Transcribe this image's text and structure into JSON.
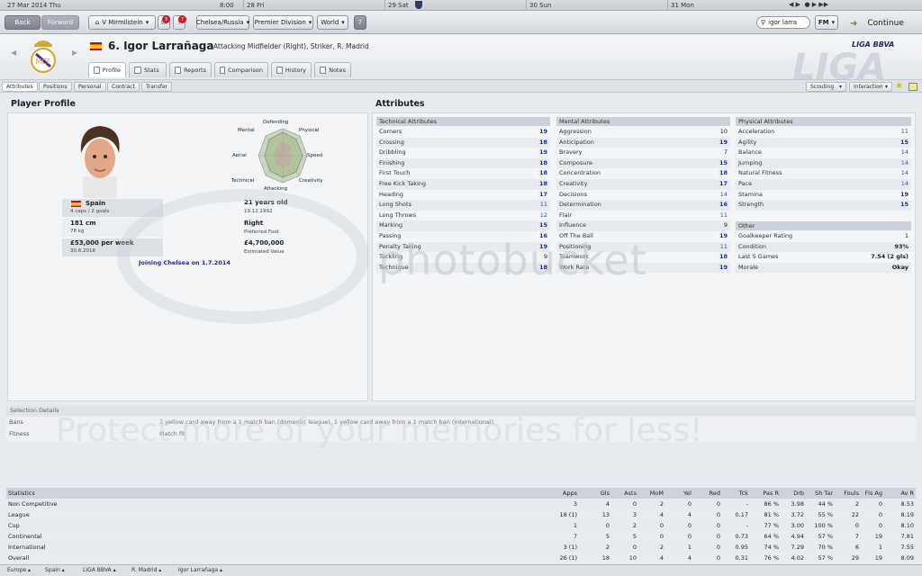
{
  "datebar": {
    "cells": [
      {
        "label": "27 Mar 2014  Thu",
        "time": "8:00"
      },
      {
        "label": "28 Fri"
      },
      {
        "label": "29 Sat"
      },
      {
        "label": "30 Sun"
      },
      {
        "label": "31 Mon"
      }
    ]
  },
  "toolbar": {
    "back": "Back",
    "forward": "Forward",
    "manager": "V Mirmilstein",
    "badge1": "3",
    "badge2": "7",
    "nation": "Chelsea/Russia",
    "division": "Premier Division",
    "world": "World",
    "help": "?",
    "search_value": "igor larra",
    "fm": "FM",
    "continue": "Continue"
  },
  "player": {
    "title": "6. Igor Larrañaga",
    "subtitle": "Attacking Midfielder (Right), Striker, R. Madrid",
    "league_logo": "LIGA BBVA",
    "tabs": [
      "Profile",
      "Stats",
      "Reports",
      "Comparison",
      "History",
      "Notes"
    ]
  },
  "subtabs": [
    "Attributes",
    "Positions",
    "Personal",
    "Contract",
    "Transfer"
  ],
  "right_buttons": {
    "scouting": "Scouting",
    "interaction": "Interaction"
  },
  "profile": {
    "heading": "Player Profile",
    "radar_labels": [
      "Defending",
      "Physical",
      "Speed",
      "Creativity",
      "Attacking",
      "Technical",
      "Aerial",
      "Mental"
    ],
    "nation": "Spain",
    "caps": "4 caps / 2 goals",
    "age": "21 years old",
    "dob": "19.12.1992",
    "height": "181 cm",
    "weight": "78 kg",
    "foot": "Right",
    "foot_label": "Preferred Foot",
    "wage": "£53,000 per week",
    "contract_end": "30.6.2016",
    "value": "£4,700,000",
    "value_label": "Estimated Value",
    "transfer_note": "Joining Chelsea on 1.7.2014"
  },
  "attributes": {
    "heading": "Attributes",
    "technical": {
      "title": "Technical Attributes",
      "items": [
        {
          "name": "Corners",
          "value": "19"
        },
        {
          "name": "Crossing",
          "value": "18"
        },
        {
          "name": "Dribbling",
          "value": "19"
        },
        {
          "name": "Finishing",
          "value": "18"
        },
        {
          "name": "First Touch",
          "value": "18"
        },
        {
          "name": "Free Kick Taking",
          "value": "18"
        },
        {
          "name": "Heading",
          "value": "17"
        },
        {
          "name": "Long Shots",
          "value": "11"
        },
        {
          "name": "Long Throws",
          "value": "12"
        },
        {
          "name": "Marking",
          "value": "15"
        },
        {
          "name": "Passing",
          "value": "16"
        },
        {
          "name": "Penalty Taking",
          "value": "19"
        },
        {
          "name": "Tackling",
          "value": "9"
        },
        {
          "name": "Technique",
          "value": "18"
        }
      ]
    },
    "mental": {
      "title": "Mental Attributes",
      "items": [
        {
          "name": "Aggression",
          "value": "10"
        },
        {
          "name": "Anticipation",
          "value": "19"
        },
        {
          "name": "Bravery",
          "value": "7"
        },
        {
          "name": "Composure",
          "value": "15"
        },
        {
          "name": "Concentration",
          "value": "18"
        },
        {
          "name": "Creativity",
          "value": "17"
        },
        {
          "name": "Decisions",
          "value": "14"
        },
        {
          "name": "Determination",
          "value": "16"
        },
        {
          "name": "Flair",
          "value": "11"
        },
        {
          "name": "Influence",
          "value": "9"
        },
        {
          "name": "Off The Ball",
          "value": "19"
        },
        {
          "name": "Positioning",
          "value": "11"
        },
        {
          "name": "Teamwork",
          "value": "18"
        },
        {
          "name": "Work Rate",
          "value": "19"
        }
      ]
    },
    "physical": {
      "title": "Physical Attributes",
      "items": [
        {
          "name": "Acceleration",
          "value": "11"
        },
        {
          "name": "Agility",
          "value": "15"
        },
        {
          "name": "Balance",
          "value": "14"
        },
        {
          "name": "Jumping",
          "value": "14"
        },
        {
          "name": "Natural Fitness",
          "value": "14"
        },
        {
          "name": "Pace",
          "value": "14"
        },
        {
          "name": "Stamina",
          "value": "19"
        },
        {
          "name": "Strength",
          "value": "15"
        }
      ]
    },
    "other": {
      "title": "Other",
      "items": [
        {
          "name": "Goalkeeper Rating",
          "value": "1"
        },
        {
          "name": "Condition",
          "value": "93%"
        },
        {
          "name": "Last 5 Games",
          "value": "7.54 (2 gls)"
        },
        {
          "name": "Morale",
          "value": "Okay"
        }
      ]
    }
  },
  "selection": {
    "title": "Selection Details",
    "bans_label": "Bans",
    "bans_value": "1 yellow card away from a 1 match ban (domestic league), 1 yellow card away from a 1 match ban (international)",
    "fitness_label": "Fitness",
    "fitness_value": "Match fit"
  },
  "statistics": {
    "headers": [
      "Statistics",
      "Apps",
      "Gls",
      "Asts",
      "MoM",
      "Yel",
      "Red",
      "Tck",
      "Pas R",
      "Drb",
      "Sh Tar",
      "Fouls",
      "Fls Ag",
      "Av R"
    ],
    "rows": [
      [
        "Non Competitive",
        "3",
        "4",
        "0",
        "2",
        "0",
        "0",
        "-",
        "86 %",
        "3.98",
        "44 %",
        "2",
        "0",
        "8.53"
      ],
      [
        "League",
        "18 (1)",
        "13",
        "3",
        "4",
        "4",
        "0",
        "0.17",
        "81 %",
        "3.72",
        "55 %",
        "22",
        "0",
        "8.19"
      ],
      [
        "Cup",
        "1",
        "0",
        "2",
        "0",
        "0",
        "0",
        "-",
        "77 %",
        "3.00",
        "100 %",
        "0",
        "0",
        "8.10"
      ],
      [
        "Continental",
        "7",
        "5",
        "5",
        "0",
        "0",
        "0",
        "0.73",
        "64 %",
        "4.94",
        "57 %",
        "7",
        "19",
        "7.81"
      ],
      [
        "International",
        "3 (1)",
        "2",
        "0",
        "2",
        "1",
        "0",
        "0.95",
        "74 %",
        "7.29",
        "70 %",
        "6",
        "1",
        "7.55"
      ],
      [
        "Overall",
        "26 (1)",
        "18",
        "10",
        "4",
        "4",
        "0",
        "0.31",
        "76 %",
        "4.02",
        "57 %",
        "29",
        "19",
        "8.09"
      ]
    ]
  },
  "footer": {
    "crumbs": [
      "Europe",
      "Spain",
      "LIGA BBVA",
      "R. Madrid",
      "Igor Larrañaga"
    ]
  },
  "watermarks": {
    "logo": "photobucket",
    "tagline": "Protect more of your memories for less!"
  },
  "colors": {
    "accent": "#1c2f8a",
    "header_band": "#cbd1d8",
    "continue_arrow": "#3f9a2a"
  }
}
